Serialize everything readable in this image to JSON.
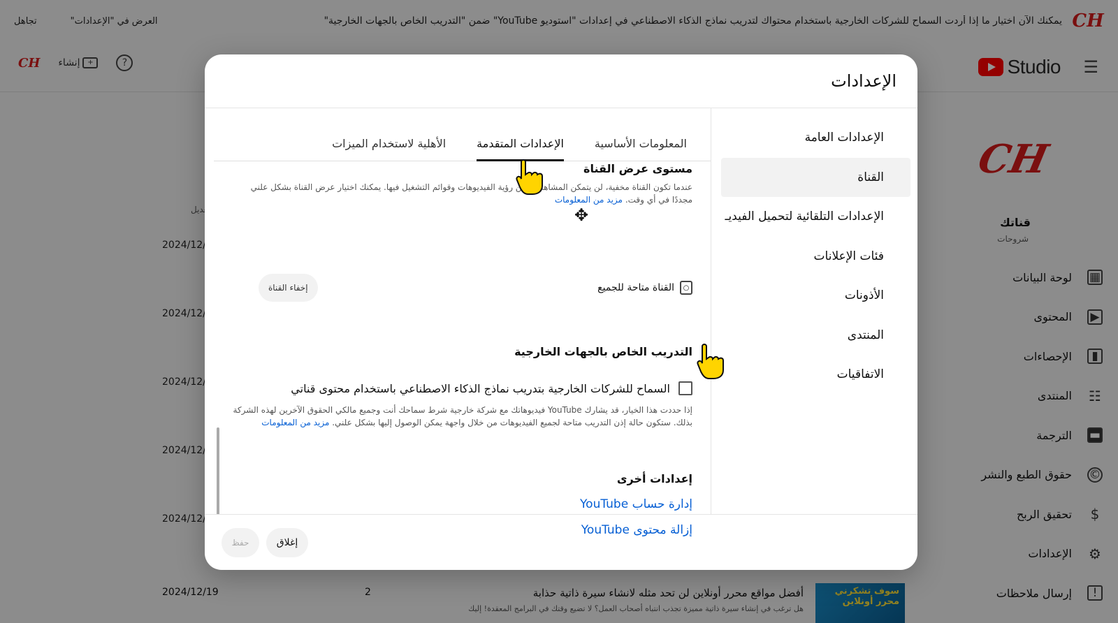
{
  "banner": {
    "text": "يمكنك الآن اختيار ما إذا أردت السماح للشركات الخارجية باستخدام محتواك لتدريب نماذج الذكاء الاصطناعي في إعدادات \"استوديو YouTube\" ضمن \"التدريب الخاص بالجهات الخارجية\"",
    "link1": "العرض في \"الإعدادات\"",
    "link2": "تجاهل"
  },
  "topbar": {
    "studio_text": "Studio",
    "create_label": "إنشاء"
  },
  "sidebar": {
    "channel_name": "قناتك",
    "channel_sub": "شروحات",
    "items": [
      {
        "label": "لوحة البيانات",
        "icon": "dashboard-icon",
        "glyph": "▦"
      },
      {
        "label": "المحتوى",
        "icon": "content-icon",
        "glyph": "▶"
      },
      {
        "label": "الإحصاءات",
        "icon": "analytics-icon",
        "glyph": "▮"
      },
      {
        "label": "المنتدى",
        "icon": "community-icon",
        "glyph": "☷"
      },
      {
        "label": "الترجمة",
        "icon": "subtitles-icon",
        "glyph": "▬"
      },
      {
        "label": "حقوق الطبع والنشر",
        "icon": "copyright-icon",
        "glyph": "©"
      },
      {
        "label": "تحقيق الربح",
        "icon": "monetization-icon",
        "glyph": "$"
      },
      {
        "label": "الإعدادات",
        "icon": "settings-icon",
        "glyph": "⚙"
      },
      {
        "label": "إرسال ملاحظات",
        "icon": "feedback-icon",
        "glyph": "!"
      }
    ]
  },
  "background": {
    "last_edit_header": "آخر تعديل",
    "dates": [
      "2024/12/",
      "2024/12/",
      "2024/12/",
      "2024/12/",
      "2024/12/"
    ],
    "bottom_row": {
      "thumb_text": "سوف تشكرني محرر أونلاين",
      "title": "أفضل مواقع محرر أونلاين لن تحد مثله لانشاء سيرة ذاتية حذابة",
      "desc": "هل ترغب في إنشاء سيرة ذاتية مميزة تجذب انتباه أصحاب العمل؟ لا تضيع وقتك في البرامج المعقدة! إليك",
      "count": "2",
      "date": "2024/12/19"
    }
  },
  "modal": {
    "title": "الإعدادات",
    "nav": [
      "الإعدادات العامة",
      "القناة",
      "الإعدادات التلقائية لتحميل الفيديـ",
      "فئات الإعلانات",
      "الأذونات",
      "المنتدى",
      "الاتفاقيات"
    ],
    "tabs": [
      "المعلومات الأساسية",
      "الإعدادات المتقدمة",
      "الأهلية لاستخدام الميزات"
    ],
    "visibility": {
      "title": "مستوى عرض القناة",
      "desc": "عندما تكون القناة مخفية، لن يتمكن المشاهدون من رؤية الفيديوهات وقوائم التشغيل فيها. يمكنك اختيار عرض القناة بشكل علني مجددًا في أي وقت.",
      "learn_more": "مزيد من المعلومات",
      "status": "القناة متاحة للجميع",
      "hide_button": "إخفاء القناة"
    },
    "training": {
      "title": "التدريب الخاص بالجهات الخارجية",
      "checkbox_label": "السماح للشركات الخارجية بتدريب نماذج الذكاء الاصطناعي باستخدام محتوى قناتي",
      "desc": "إذا حددت هذا الخيار، قد يشارك YouTube فيديوهاتك مع شركة خارجية شرط سماحك أنت وجميع مالكي الحقوق الآخرين لهذه الشركة بذلك. ستكون حالة إذن التدريب متاحة لجميع الفيديوهات من خلال واجهة يمكن الوصول إليها بشكل علني.",
      "learn_more": "مزيد من المعلومات"
    },
    "other": {
      "title": "إعدادات أخرى",
      "link1": "إدارة حساب YouTube",
      "link2": "إزالة محتوى YouTube"
    },
    "footer": {
      "close": "إغلاق",
      "save": "حفظ"
    }
  }
}
